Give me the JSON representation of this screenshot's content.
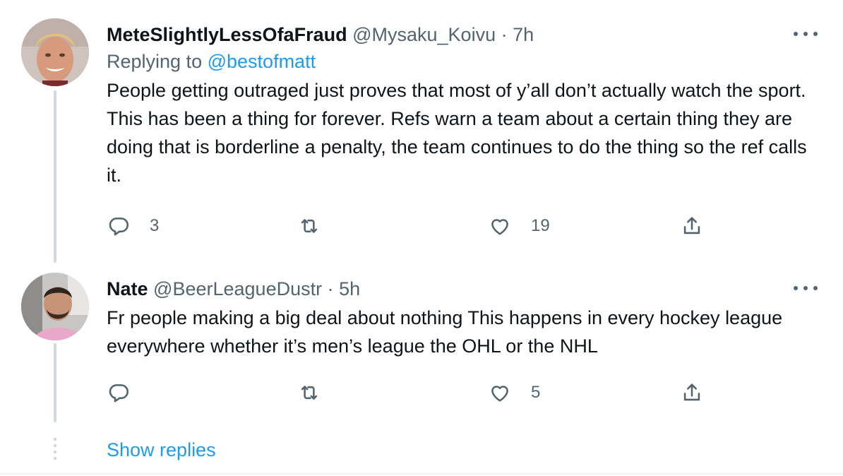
{
  "tweets": [
    {
      "name": "MeteSlightlyLessOfaFraud",
      "handle": "@Mysaku_Koivu",
      "separator": "·",
      "time": "7h",
      "replying_label": "Replying to",
      "replying_to": "@bestofmatt",
      "text": "People getting outraged just proves that most of y’all don’t actually watch the sport. This has been a thing for forever. Refs warn a team about a certain thing they are doing that is borderline a penalty, the team continues to do the thing so the ref calls it.",
      "reply_count": "3",
      "retweet_count": "",
      "like_count": "19",
      "avatar_icon": "user-avatar-blond-man"
    },
    {
      "name": "Nate",
      "handle": "@BeerLeagueDustr",
      "separator": "·",
      "time": "5h",
      "text": "Fr people making a big deal about nothing This happens in every hockey league everywhere whether it’s men’s league the OHL or the NHL",
      "reply_count": "",
      "retweet_count": "",
      "like_count": "5",
      "avatar_icon": "user-avatar-man-in-car"
    }
  ],
  "show_replies_label": "Show replies",
  "colors": {
    "link": "#1d9bf0",
    "secondary_text": "#536471",
    "primary_text": "#0f1419",
    "thread_line": "#cfd9de"
  }
}
